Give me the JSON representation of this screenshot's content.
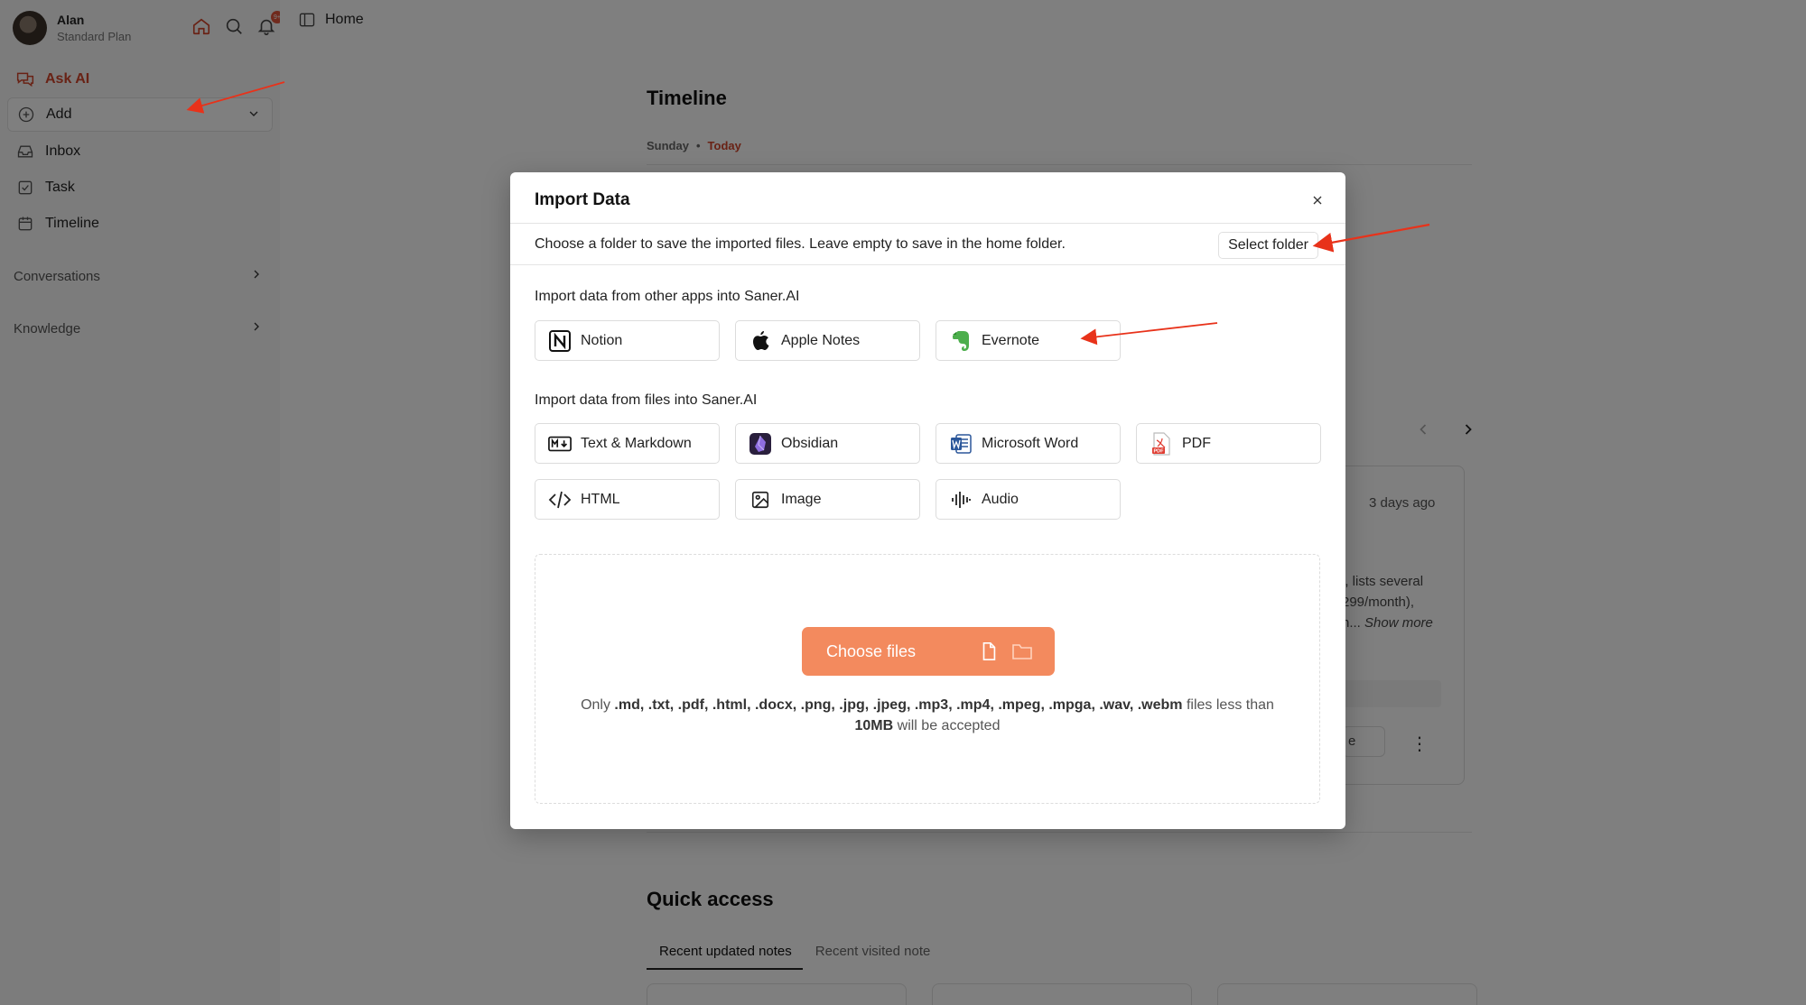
{
  "sidebar": {
    "user": {
      "name": "Alan",
      "plan": "Standard Plan"
    },
    "notification_badge": "9+",
    "items": [
      {
        "label": "Ask AI",
        "icon": "chat-icon"
      },
      {
        "label": "Add",
        "icon": "plus-circle-icon"
      },
      {
        "label": "Inbox",
        "icon": "inbox-icon"
      },
      {
        "label": "Task",
        "icon": "checkbox-icon"
      },
      {
        "label": "Timeline",
        "icon": "calendar-icon"
      }
    ],
    "sections": [
      {
        "label": "Conversations"
      },
      {
        "label": "Knowledge"
      }
    ]
  },
  "header": {
    "title": "Home"
  },
  "timeline": {
    "title": "Timeline",
    "day": "Sunday",
    "today": "Today",
    "card": {
      "ago": "3 days ago",
      "text_line1": "l, lists several",
      "text_line2": "299/month),",
      "text_line3_prefix": "n... ",
      "show_more": "Show more",
      "button_text": "e"
    }
  },
  "quick_access": {
    "title": "Quick access",
    "tabs": [
      "Recent updated notes",
      "Recent visited note"
    ]
  },
  "modal": {
    "title": "Import Data",
    "folder_text": "Choose a folder to save the imported files. Leave empty to save in the home folder.",
    "select_folder": "Select folder",
    "apps_section": "Import data from other apps into Saner.AI",
    "apps": [
      {
        "label": "Notion",
        "icon": "notion-icon"
      },
      {
        "label": "Apple Notes",
        "icon": "apple-icon"
      },
      {
        "label": "Evernote",
        "icon": "evernote-icon"
      }
    ],
    "files_section": "Import data from files into Saner.AI",
    "files": [
      {
        "label": "Text & Markdown",
        "icon": "markdown-icon"
      },
      {
        "label": "Obsidian",
        "icon": "obsidian-icon"
      },
      {
        "label": "Microsoft Word",
        "icon": "word-icon"
      },
      {
        "label": "PDF",
        "icon": "pdf-icon"
      },
      {
        "label": "HTML",
        "icon": "code-icon"
      },
      {
        "label": "Image",
        "icon": "image-icon"
      },
      {
        "label": "Audio",
        "icon": "audio-waveform-icon"
      }
    ],
    "choose_files": "Choose files",
    "note_prefix": "Only ",
    "note_formats": ".md, .txt, .pdf, .html, .docx, .png, .jpg, .jpeg, .mp3, .mp4, .mpeg, .mpga, .wav, .webm",
    "note_mid": " files less than ",
    "note_size": "10MB",
    "note_suffix": " will be accepted"
  },
  "colors": {
    "accent": "#d2452b",
    "choose_button": "#f38a5e",
    "annotation_arrow": "#e8321a"
  }
}
